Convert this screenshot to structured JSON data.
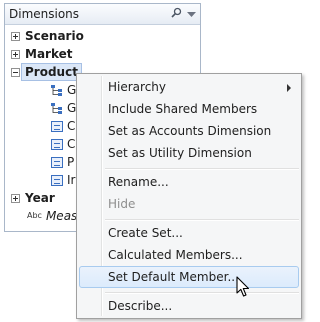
{
  "panel": {
    "title": "Dimensions",
    "icons": [
      "search-icon",
      "dropdown-arrow-icon"
    ]
  },
  "tree": {
    "nodes": [
      {
        "label": "Scenario",
        "state": "collapsed"
      },
      {
        "label": "Market",
        "state": "collapsed"
      },
      {
        "label": "Product",
        "state": "expanded",
        "selected": true
      },
      {
        "label": "Year",
        "state": "collapsed"
      }
    ],
    "product_children": [
      {
        "label": "G",
        "icon": "hierarchy-icon"
      },
      {
        "label": "G",
        "icon": "hierarchy-icon"
      },
      {
        "label": "C",
        "icon": "member-icon"
      },
      {
        "label": "C",
        "icon": "member-icon"
      },
      {
        "label": "P",
        "icon": "member-icon"
      },
      {
        "label": "Ir",
        "icon": "member-icon"
      }
    ],
    "measures": {
      "prefix": "Abc",
      "label": "Meas"
    }
  },
  "context_menu": {
    "items": [
      {
        "label": "Hierarchy",
        "has_submenu": true
      },
      {
        "label": "Include Shared Members"
      },
      {
        "label": "Set as Accounts Dimension"
      },
      {
        "label": "Set as Utility Dimension"
      },
      {
        "label": "Rename..."
      },
      {
        "label": "Hide",
        "disabled": true
      },
      {
        "label": "Create Set..."
      },
      {
        "label": "Calculated Members..."
      },
      {
        "label": "Set Default Member...",
        "hovered": true
      },
      {
        "label": "Describe..."
      }
    ]
  }
}
